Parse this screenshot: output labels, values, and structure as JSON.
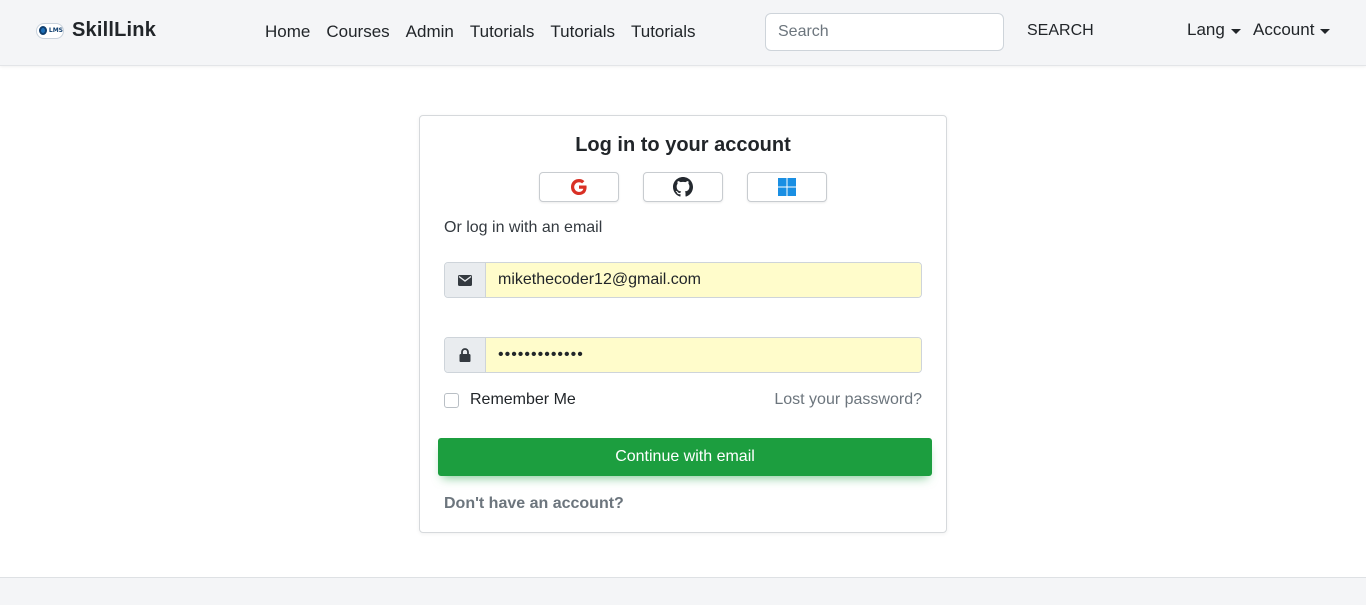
{
  "brand": {
    "logo_text": "LMS",
    "name": "SkillLink"
  },
  "nav": {
    "links": [
      "Home",
      "Courses",
      "Admin",
      "Tutorials",
      "Tutorials",
      "Tutorials"
    ],
    "search_placeholder": "Search",
    "search_button": "SEARCH",
    "lang_label": "Lang",
    "account_label": "Account"
  },
  "login": {
    "title": "Log in to your account",
    "social_icons": [
      "google-icon",
      "github-icon",
      "windows-icon"
    ],
    "or_text": "Or log in with an email",
    "email_icon": "envelope-icon",
    "email_value": "mikethecoder12@gmail.com",
    "password_icon": "lock-icon",
    "password_mask": "•••••••••••••",
    "remember_label": "Remember Me",
    "remember_checked": false,
    "lost_password": "Lost your password?",
    "continue_button": "Continue with email",
    "signup_link": "Don't have an account?"
  },
  "colors": {
    "navbar_bg": "#f4f5f7",
    "primary_green": "#1c9e3f",
    "autofill_yellow": "#fffccb",
    "muted_text": "#6c757d"
  }
}
